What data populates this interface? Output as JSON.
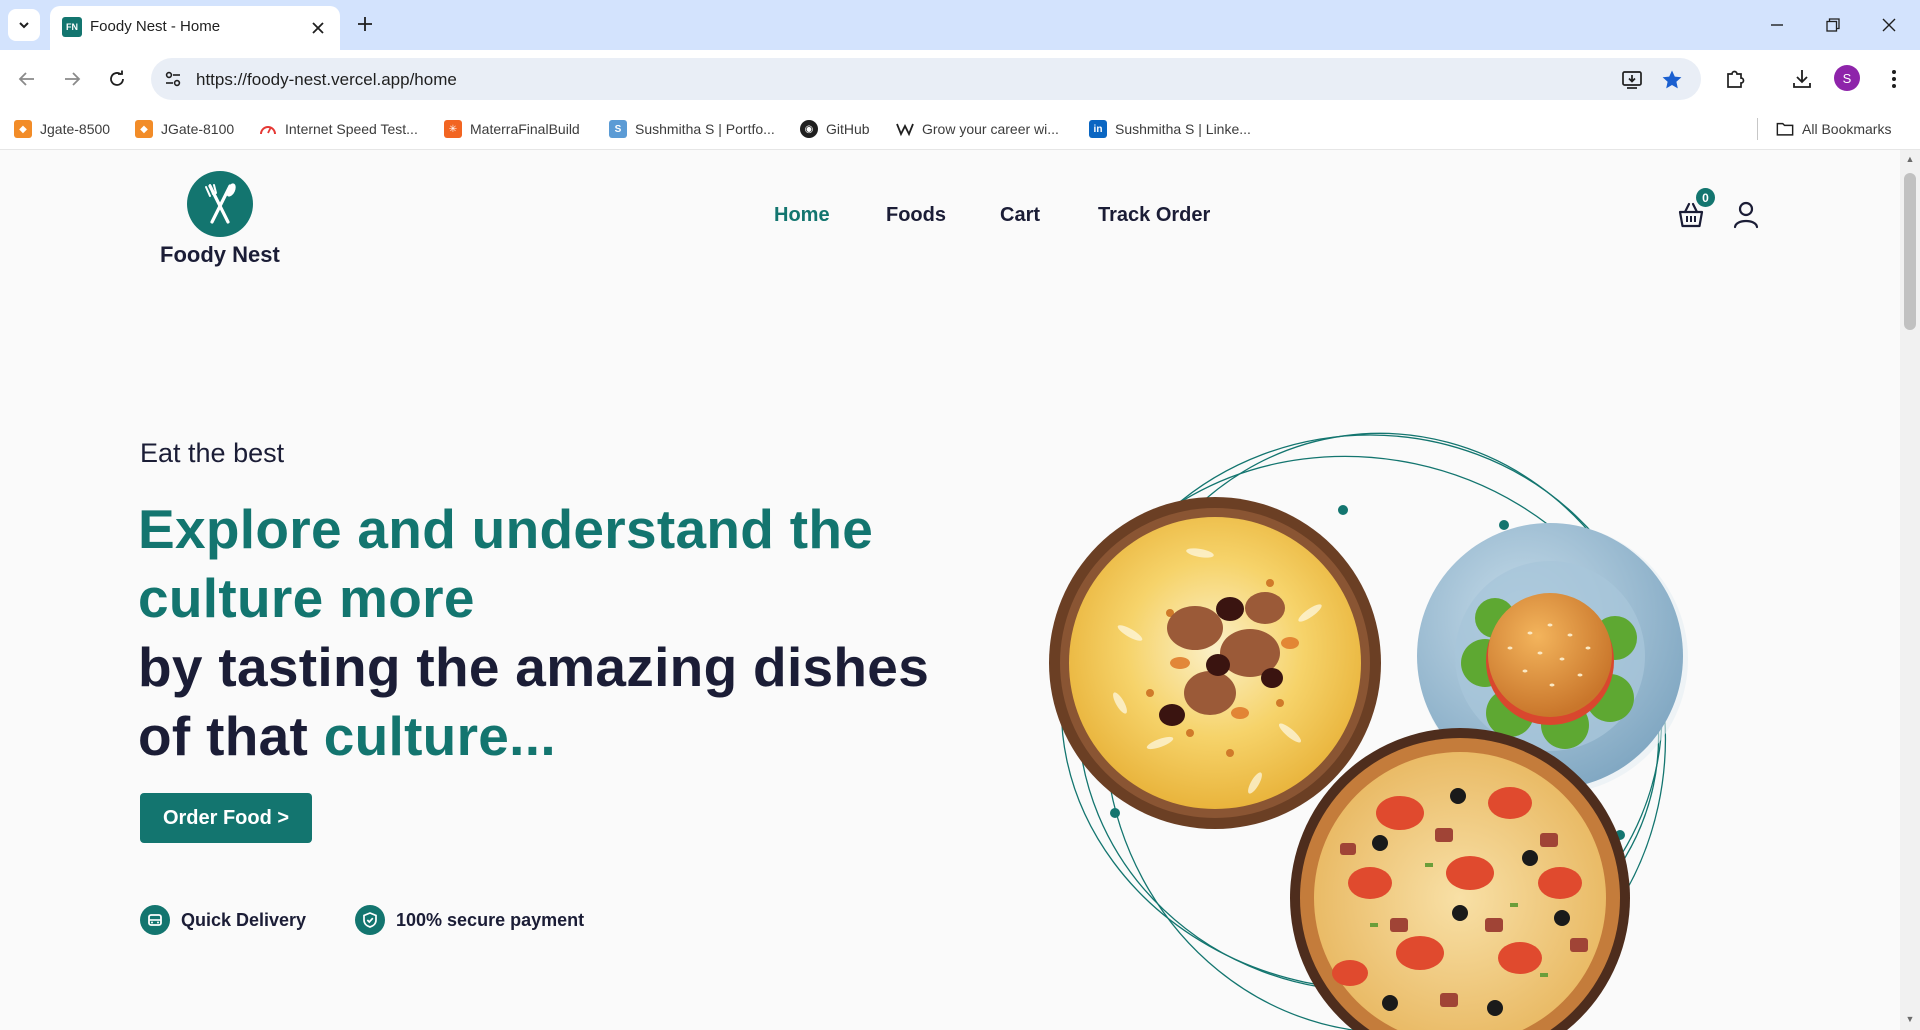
{
  "browser": {
    "tab_title": "Foody Nest - Home",
    "tab_favicon_text": "FN",
    "url": "https://foody-nest.vercel.app/home",
    "profile_initial": "S",
    "bookmarks": [
      {
        "label": "Jgate-8500",
        "icon_color": "#f28c28"
      },
      {
        "label": "JGate-8100",
        "icon_color": "#f28c28"
      },
      {
        "label": "Internet Speed Test...",
        "icon_color": "#e53935"
      },
      {
        "label": "MaterraFinalBuild",
        "icon_color": "#f26522"
      },
      {
        "label": "Sushmitha S | Portfo...",
        "icon_color": "#5b9bd5"
      },
      {
        "label": "GitHub",
        "icon_color": "#1f1f1f"
      },
      {
        "label": "Grow your career wi...",
        "icon_color": "#1f1f1f"
      },
      {
        "label": "Sushmitha S | Linke...",
        "icon_color": "#0a66c2"
      }
    ],
    "all_bookmarks_label": "All Bookmarks"
  },
  "site": {
    "brand": "Foody Nest",
    "nav": [
      {
        "label": "Home",
        "active": true
      },
      {
        "label": "Foods",
        "active": false
      },
      {
        "label": "Cart",
        "active": false
      },
      {
        "label": "Track Order",
        "active": false
      }
    ],
    "cart_count": "0"
  },
  "hero": {
    "eyebrow": "Eat the best",
    "headline_line1_teal": "Explore and understand the",
    "headline_line2_teal": "culture more",
    "headline_line3": "by tasting the amazing dishes",
    "headline_line4_dark": "of that ",
    "headline_line4_teal": "culture...",
    "cta_label": "Order Food >",
    "features": [
      {
        "label": "Quick Delivery",
        "icon": "car-icon"
      },
      {
        "label": "100% secure payment",
        "icon": "shield-check-icon"
      }
    ]
  },
  "colors": {
    "brand_teal": "#13756f",
    "text_dark": "#1b1d36",
    "chrome_blue": "#d3e3fd"
  }
}
